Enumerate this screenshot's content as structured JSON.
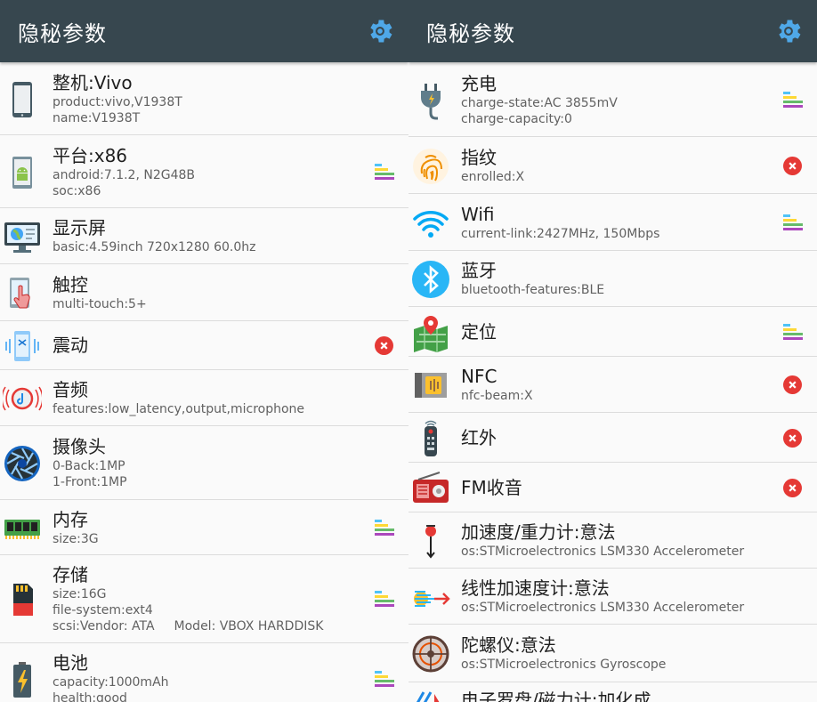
{
  "left": {
    "title": "隐秘参数",
    "rows": [
      {
        "name": "整机:Vivo",
        "details": [
          "product:vivo,V1938T",
          "name:V1938T"
        ],
        "status": ""
      },
      {
        "name": "平台:x86",
        "details": [
          "android:7.1.2, N2G48B",
          "soc:x86"
        ],
        "status": "bars"
      },
      {
        "name": "显示屏",
        "details": [
          "basic:4.59inch 720x1280 60.0hz"
        ],
        "status": ""
      },
      {
        "name": "触控",
        "details": [
          "multi-touch:5+"
        ],
        "status": ""
      },
      {
        "name": "震动",
        "details": [],
        "status": "x"
      },
      {
        "name": "音频",
        "details": [
          "features:low_latency,output,microphone"
        ],
        "status": ""
      },
      {
        "name": "摄像头",
        "details": [
          "0-Back:1MP",
          "1-Front:1MP"
        ],
        "status": ""
      },
      {
        "name": "内存",
        "details": [
          "size:3G"
        ],
        "status": "bars"
      },
      {
        "name": "存储",
        "details": [
          "size:16G",
          "file-system:ext4",
          "scsi:Vendor: ATA"
        ],
        "extra": "Model: VBOX HARDDISK",
        "status": "bars"
      },
      {
        "name": "电池",
        "details": [
          "capacity:1000mAh",
          "health:good"
        ],
        "status": "bars"
      }
    ]
  },
  "right": {
    "title": "隐秘参数",
    "rows": [
      {
        "name": "充电",
        "details": [
          "charge-state:AC 3855mV",
          "charge-capacity:0"
        ],
        "status": "bars"
      },
      {
        "name": "指纹",
        "details": [
          "enrolled:X"
        ],
        "status": "x"
      },
      {
        "name": "Wifi",
        "details": [
          "current-link:2427MHz, 150Mbps"
        ],
        "status": "bars"
      },
      {
        "name": "蓝牙",
        "details": [
          "bluetooth-features:BLE"
        ],
        "status": ""
      },
      {
        "name": "定位",
        "details": [],
        "status": "bars"
      },
      {
        "name": "NFC",
        "details": [
          "nfc-beam:X"
        ],
        "status": "x"
      },
      {
        "name": "红外",
        "details": [],
        "status": "x"
      },
      {
        "name": "FM收音",
        "details": [],
        "status": "x"
      },
      {
        "name": "加速度/重力计:意法",
        "details": [
          "os:STMicroelectronics LSM330 Accelerometer"
        ],
        "status": ""
      },
      {
        "name": "线性加速度计:意法",
        "details": [
          "os:STMicroelectronics LSM330 Accelerometer"
        ],
        "status": ""
      },
      {
        "name": "陀螺仪:意法",
        "details": [
          "os:STMicroelectronics Gyroscope"
        ],
        "status": ""
      },
      {
        "name": "电子罗盘/磁力计:加化成",
        "details": [],
        "status": ""
      }
    ]
  },
  "colors": {
    "appbar": "#37474f",
    "gear": "#4fa8e8",
    "status_x": "#e53935",
    "bars": [
      "#4fc3f7",
      "#fdd835",
      "#66bb6a",
      "#ab47bc"
    ]
  },
  "icons": {
    "left": [
      "phone-icon",
      "android-icon",
      "monitor-icon",
      "touch-hand-icon",
      "vibration-icon",
      "audio-icon",
      "camera-aperture-icon",
      "memory-chip-icon",
      "sd-card-icon",
      "battery-icon"
    ],
    "right": [
      "charger-plug-icon",
      "fingerprint-icon",
      "wifi-icon",
      "bluetooth-icon",
      "map-location-icon",
      "nfc-chip-icon",
      "remote-control-icon",
      "radio-icon",
      "accelerometer-icon",
      "linear-accel-icon",
      "gyroscope-icon",
      "compass-icon"
    ]
  }
}
